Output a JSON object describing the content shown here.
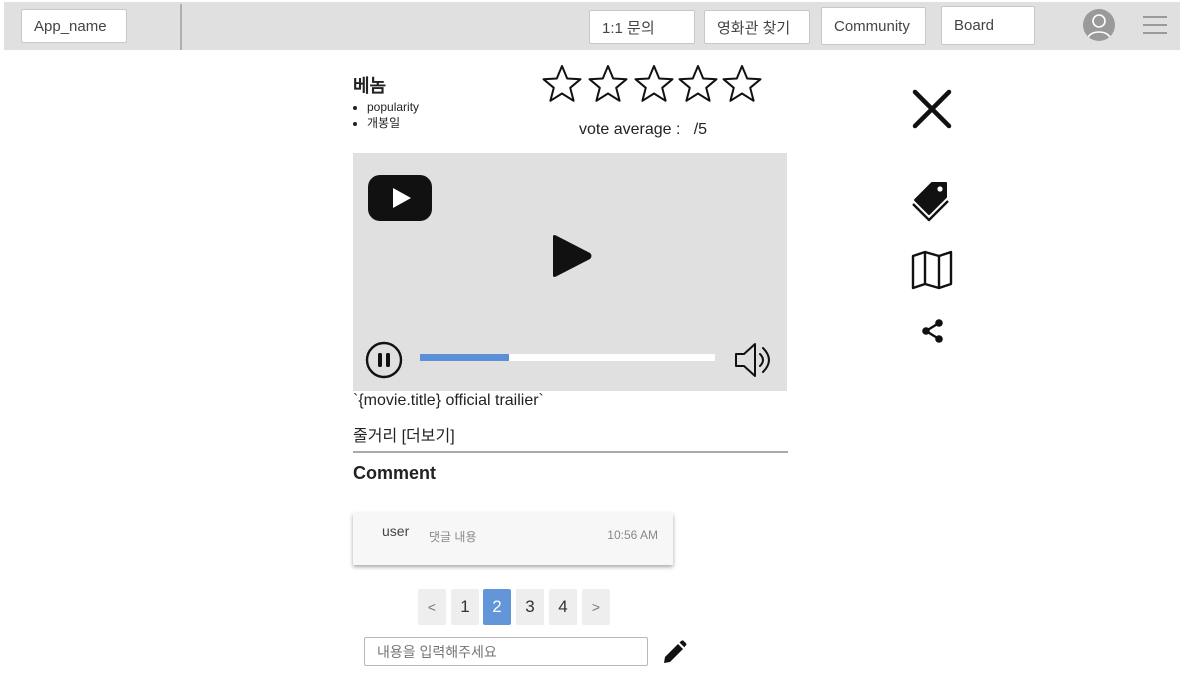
{
  "header": {
    "app_name": "App_name",
    "nav": [
      "1:1 문의",
      "영화관 찾기",
      "Community",
      "Board"
    ]
  },
  "movie": {
    "title": "베놈",
    "meta": [
      "popularity",
      "개봉일"
    ],
    "rating": {
      "stars_total": 5,
      "stars_filled": 0
    },
    "vote_average_label": "vote average :   /5"
  },
  "video": {
    "trailer_title": "`{movie.title} official trailier`",
    "progress_fraction": 0.3
  },
  "plot_label": "줄거리 [더보기]",
  "comments": {
    "heading": "Comment",
    "items": [
      {
        "user": "user",
        "text": "댓글 내용",
        "time": "10:56 AM"
      }
    ],
    "input_placeholder": "내용을 입력해주세요"
  },
  "pagination": {
    "prev": "<",
    "pages": [
      "1",
      "2",
      "3",
      "4"
    ],
    "active": "2",
    "next": ">"
  },
  "icons": {
    "close": "close-icon",
    "tag": "tag-icon",
    "map": "map-icon",
    "share": "share-icon",
    "edit": "pencil-icon",
    "youtube": "youtube-logo-icon",
    "play": "play-icon",
    "pause": "pause-icon",
    "volume": "volume-icon",
    "avatar": "user-avatar-icon",
    "menu": "hamburger-menu-icon"
  },
  "colors": {
    "accent": "#6296d8",
    "progress": "#5b8fd6",
    "header_bg": "#e0e0e0",
    "video_bg": "#e0e0e0"
  }
}
